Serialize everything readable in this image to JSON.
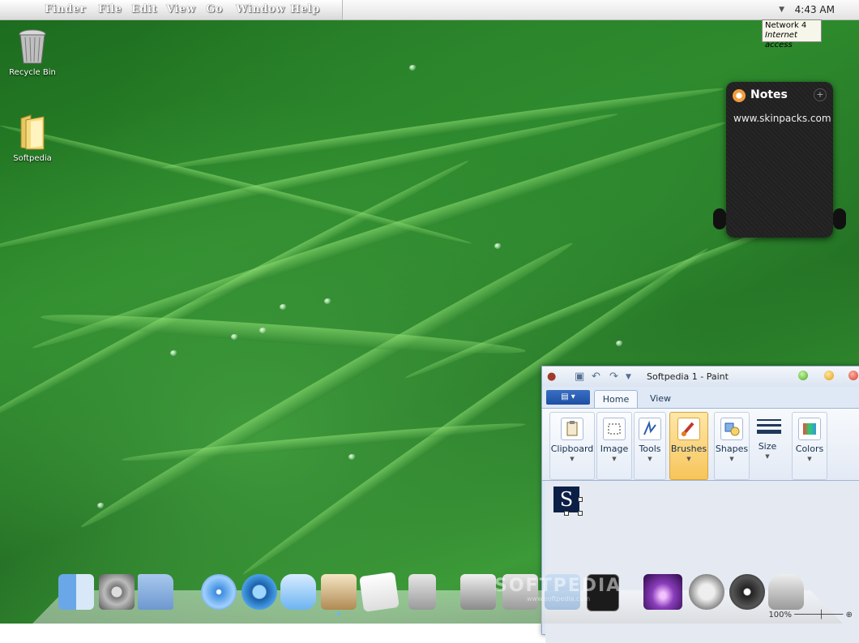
{
  "menubar": {
    "apple_glyph": "",
    "items": [
      "Finder",
      "File",
      "Edit",
      "View",
      "Go",
      "Window",
      "Help"
    ],
    "clock": "4:43 AM"
  },
  "network_tooltip": {
    "line1": "Network  4",
    "line2": "Internet access"
  },
  "desktop_icons": [
    {
      "label": "Recycle Bin",
      "icon": "trash-icon"
    },
    {
      "label": "Softpedia",
      "icon": "folder-icon"
    }
  ],
  "notes": {
    "title": "Notes",
    "text": "www.skinpacks.com"
  },
  "paint": {
    "title": "Softpedia 1 - Paint",
    "tabs": [
      "Home",
      "View"
    ],
    "groups": [
      {
        "label": "Clipboard",
        "icon": "clipboard-icon"
      },
      {
        "label": "Image",
        "icon": "select-icon"
      },
      {
        "label": "Tools",
        "icon": "tools-icon"
      },
      {
        "label": "Brushes",
        "icon": "brush-icon"
      },
      {
        "label": "Shapes",
        "icon": "shapes-icon"
      },
      {
        "label": "Size",
        "icon": "size-icon"
      },
      {
        "label": "Colors",
        "icon": "colors-icon"
      }
    ],
    "canvas_glyph": "S",
    "zoom": "100%"
  },
  "watermark": {
    "text": "SOFTPEDIA",
    "url": "www.softpedia.com"
  },
  "colors": {
    "paint_accent": "#1d4fa3",
    "selected_group": "#f7c55a"
  }
}
